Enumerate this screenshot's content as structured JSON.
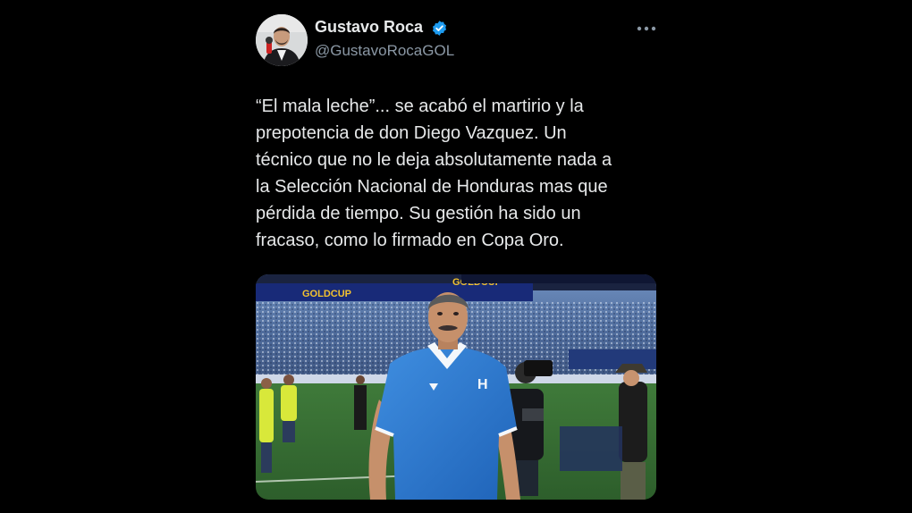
{
  "tweet": {
    "author": {
      "display_name": "Gustavo Roca",
      "handle": "@GustavoRocaGOL",
      "verified": true,
      "verified_color": "#1d9bf0"
    },
    "text_lines": [
      "“El mala leche”... se acabó el martirio y la",
      "prepotencia de don Diego Vazquez. Un",
      "técnico que no le deja absolutamente nada a",
      "la Selección Nacional de Honduras mas que",
      "pérdida de tiempo. Su gestión ha sido un",
      "fracaso, como lo firmado en Copa Oro."
    ],
    "media": {
      "banner_text": "GOLDCUP"
    }
  },
  "colors": {
    "background": "#000000",
    "text_primary": "#e7e9ea",
    "text_secondary": "#8b98a5"
  }
}
